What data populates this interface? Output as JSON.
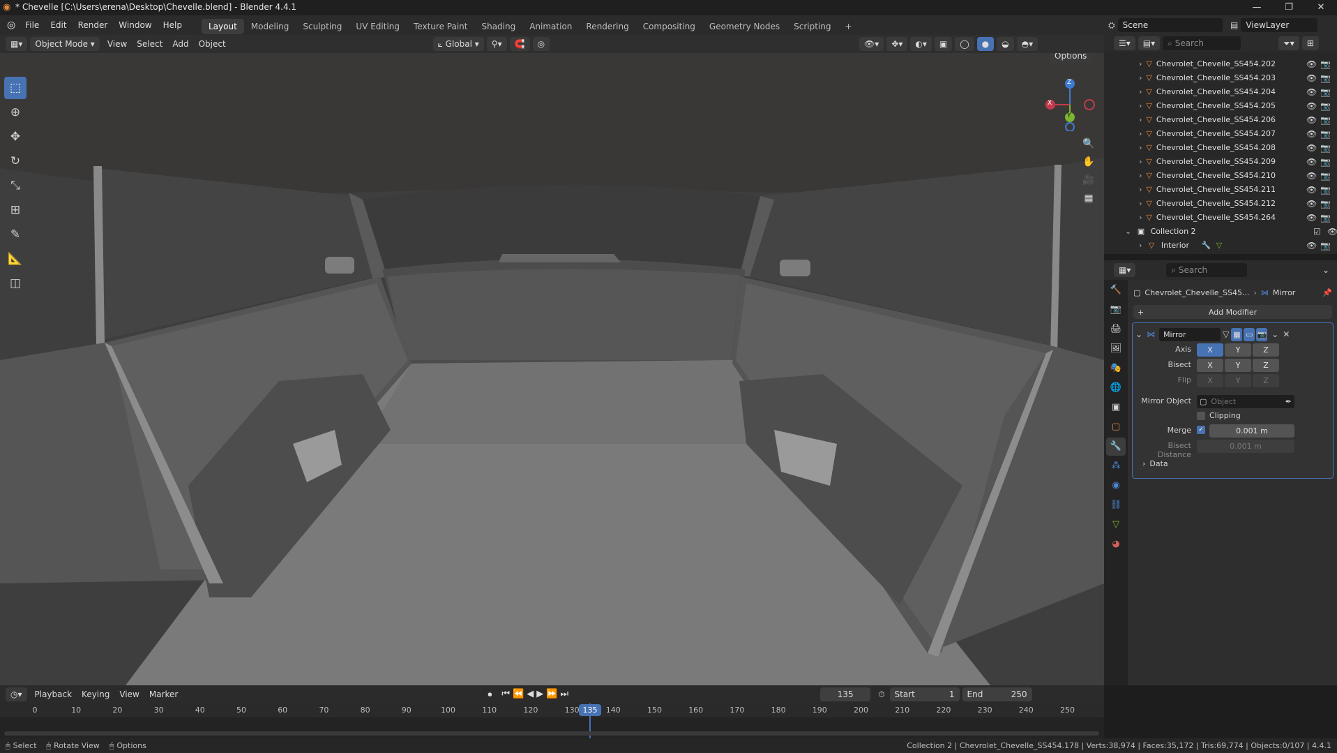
{
  "title": "* Chevelle [C:\\Users\\erena\\Desktop\\Chevelle.blend] - Blender 4.4.1",
  "window_buttons": [
    "—",
    "❐",
    "✕"
  ],
  "menus": [
    "File",
    "Edit",
    "Render",
    "Window",
    "Help"
  ],
  "workspaces": [
    "Layout",
    "Modeling",
    "Sculpting",
    "UV Editing",
    "Texture Paint",
    "Shading",
    "Animation",
    "Rendering",
    "Compositing",
    "Geometry Nodes",
    "Scripting",
    "+"
  ],
  "scene": {
    "name": "Scene",
    "view_layer": "ViewLayer"
  },
  "viewport_header": {
    "mode": "Object Mode",
    "menus": [
      "View",
      "Select",
      "Add",
      "Object"
    ],
    "transform": "Global",
    "options": "Options"
  },
  "gizmo": {
    "x": "X",
    "y": "Y",
    "z": "Z"
  },
  "outliner": {
    "search_placeholder": "Search",
    "items": [
      {
        "label": "Chevrolet_Chevelle_SS454.202"
      },
      {
        "label": "Chevrolet_Chevelle_SS454.203"
      },
      {
        "label": "Chevrolet_Chevelle_SS454.204"
      },
      {
        "label": "Chevrolet_Chevelle_SS454.205"
      },
      {
        "label": "Chevrolet_Chevelle_SS454.206"
      },
      {
        "label": "Chevrolet_Chevelle_SS454.207"
      },
      {
        "label": "Chevrolet_Chevelle_SS454.208"
      },
      {
        "label": "Chevrolet_Chevelle_SS454.209"
      },
      {
        "label": "Chevrolet_Chevelle_SS454.210"
      },
      {
        "label": "Chevrolet_Chevelle_SS454.211"
      },
      {
        "label": "Chevrolet_Chevelle_SS454.212"
      },
      {
        "label": "Chevrolet_Chevelle_SS454.264"
      }
    ],
    "collection": "Collection 2",
    "child": "Interior"
  },
  "properties": {
    "search_placeholder": "Search",
    "breadcrumb_object": "Chevrolet_Chevelle_SS45...",
    "breadcrumb_modifier": "Mirror",
    "add_modifier": "Add Modifier",
    "modifier_name": "Mirror",
    "axis_label": "Axis",
    "bisect_label": "Bisect",
    "flip_label": "Flip",
    "axes": [
      "X",
      "Y",
      "Z"
    ],
    "mirror_object_label": "Mirror Object",
    "mirror_object_placeholder": "Object",
    "clipping_label": "Clipping",
    "merge_label": "Merge",
    "merge_value": "0.001 m",
    "bisect_distance_label": "Bisect Distance",
    "bisect_distance_value": "0.001 m",
    "data_label": "Data"
  },
  "timeline": {
    "menus": [
      "Playback",
      "Keying",
      "View",
      "Marker"
    ],
    "current_frame": "135",
    "start_label": "Start",
    "start": "1",
    "end_label": "End",
    "end": "250",
    "ticks": [
      "0",
      "10",
      "20",
      "30",
      "40",
      "50",
      "60",
      "70",
      "80",
      "90",
      "100",
      "110",
      "120",
      "130",
      "140",
      "150",
      "160",
      "170",
      "180",
      "190",
      "200",
      "210",
      "220",
      "230",
      "240",
      "250"
    ]
  },
  "statusbar": {
    "select": "Select",
    "rotate": "Rotate View",
    "options": "Options",
    "info": "Collection 2 | Chevrolet_Chevelle_SS454.178 | Verts:38,974 | Faces:35,172 | Tris:69,774 | Objects:0/107 | 4.4.1"
  },
  "colors": {
    "accent": "#4772b3",
    "axis_x": "#c33c4c",
    "axis_y": "#79b531",
    "axis_z": "#3d7ad1",
    "mesh_icon": "#e88a3c"
  }
}
